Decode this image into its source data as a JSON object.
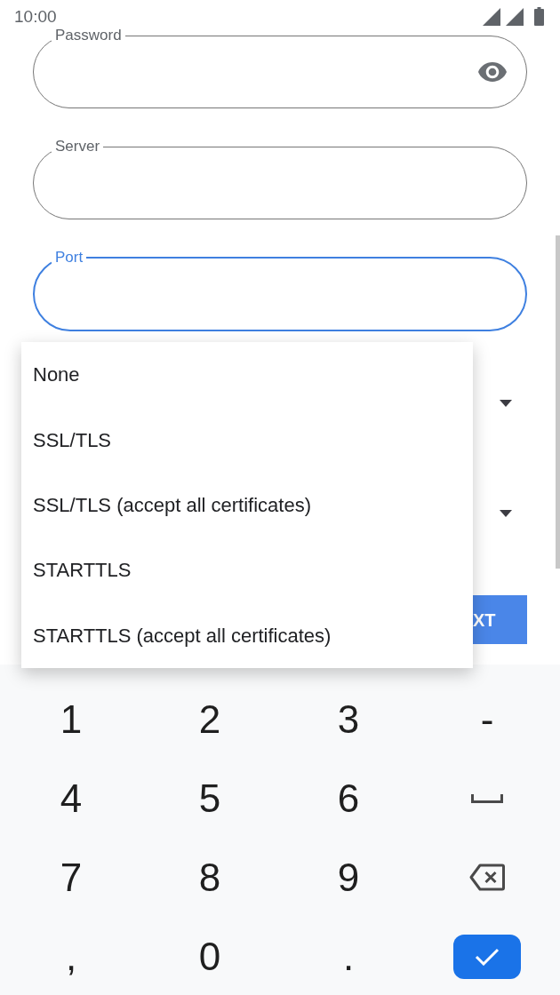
{
  "status_bar": {
    "time": "10:00"
  },
  "form": {
    "fields": [
      {
        "label": "Password",
        "kind": "password",
        "focused": false
      },
      {
        "label": "Server",
        "kind": "text",
        "focused": false
      },
      {
        "label": "Port",
        "kind": "text",
        "focused": true
      }
    ],
    "next_button": {
      "label": "XT"
    }
  },
  "dropdown_menu": {
    "options": [
      {
        "label": "None",
        "selected": false
      },
      {
        "label": "SSL/TLS",
        "selected": false
      },
      {
        "label": "SSL/TLS (accept all certificates)",
        "selected": false
      },
      {
        "label": "STARTTLS",
        "selected": false
      },
      {
        "label": "STARTTLS (accept all certificates)",
        "selected": false
      }
    ]
  },
  "keyboard": {
    "keys": [
      {
        "kind": "char",
        "label": "1"
      },
      {
        "kind": "char",
        "label": "2"
      },
      {
        "kind": "char",
        "label": "3"
      },
      {
        "kind": "char",
        "label": "-"
      },
      {
        "kind": "char",
        "label": "4"
      },
      {
        "kind": "char",
        "label": "5"
      },
      {
        "kind": "char",
        "label": "6"
      },
      {
        "kind": "space"
      },
      {
        "kind": "char",
        "label": "7"
      },
      {
        "kind": "char",
        "label": "8"
      },
      {
        "kind": "char",
        "label": "9"
      },
      {
        "kind": "backspace"
      },
      {
        "kind": "char",
        "label": ","
      },
      {
        "kind": "char",
        "label": "0"
      },
      {
        "kind": "char",
        "label": "."
      },
      {
        "kind": "done"
      }
    ]
  }
}
